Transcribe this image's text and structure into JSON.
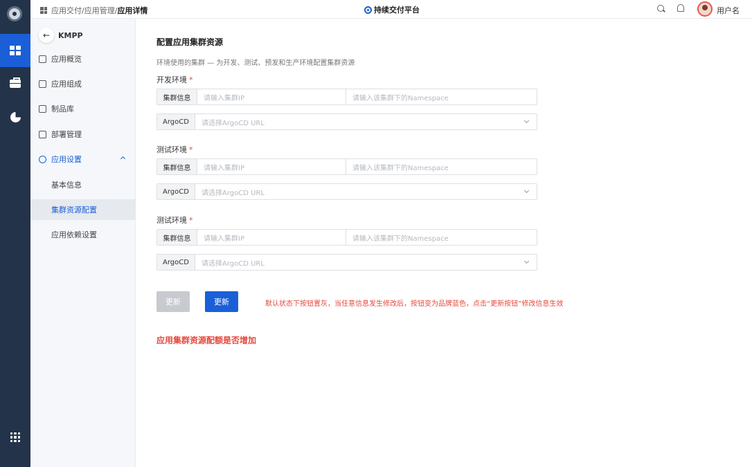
{
  "topbar": {
    "breadcrumb": [
      "应用交付/",
      "应用管理/ "
    ],
    "breadcrumb_current": "应用详情",
    "platform_name": "持续交付平台",
    "user_name": "用户名"
  },
  "rail": {
    "items": [
      "grid-icon",
      "toolbox-icon",
      "pie-chart-icon"
    ],
    "bottom": "apps-icon",
    "active_index": 0
  },
  "sidebar": {
    "project": "KMPP",
    "items": [
      {
        "label": "应用概览",
        "icon": "map-icon"
      },
      {
        "label": "应用组成",
        "icon": "components-icon"
      },
      {
        "label": "制品库",
        "icon": "inbox-icon"
      },
      {
        "label": "部署管理",
        "icon": "rocket-icon"
      },
      {
        "label": "应用设置",
        "icon": "settings-icon",
        "expanded": true
      }
    ],
    "sub_items": [
      {
        "label": "基本信息"
      },
      {
        "label": "集群资源配置",
        "active": true
      },
      {
        "label": "应用依赖设置"
      }
    ]
  },
  "main": {
    "title": "配置应用集群资源",
    "description": "环境使用的集群 — 为开发、测试、预发和生产环境配置集群资源",
    "envs": [
      {
        "label": "开发环境",
        "cluster_addon": "集群信息",
        "ip_placeholder": "请输入集群IP",
        "ns_placeholder": "请输入该集群下的Namespace",
        "argocd_addon": "ArgoCD",
        "argocd_placeholder": "请选择ArgoCD URL"
      },
      {
        "label": "测试环境",
        "cluster_addon": "集群信息",
        "ip_placeholder": "请输入集群IP",
        "ns_placeholder": "请输入该集群下的Namespace",
        "argocd_addon": "ArgoCD",
        "argocd_placeholder": "请选择ArgoCD URL"
      },
      {
        "label": "测试环境",
        "cluster_addon": "集群信息",
        "ip_placeholder": "请输入集群IP",
        "ns_placeholder": "请输入该集群下的Namespace",
        "argocd_addon": "ArgoCD",
        "argocd_placeholder": "请选择ArgoCD URL"
      }
    ],
    "update_disabled": "更新",
    "update_active": "更新",
    "annotation": "默认状态下按钮置灰，当任意信息发生修改后，按钮变为品牌蓝色，点击“更新按钮”修改信息生效",
    "question": "应用集群资源配额是否增加"
  },
  "colors": {
    "brand": "#1a5fd8",
    "rail": "#233349",
    "required": "#e5483c"
  }
}
